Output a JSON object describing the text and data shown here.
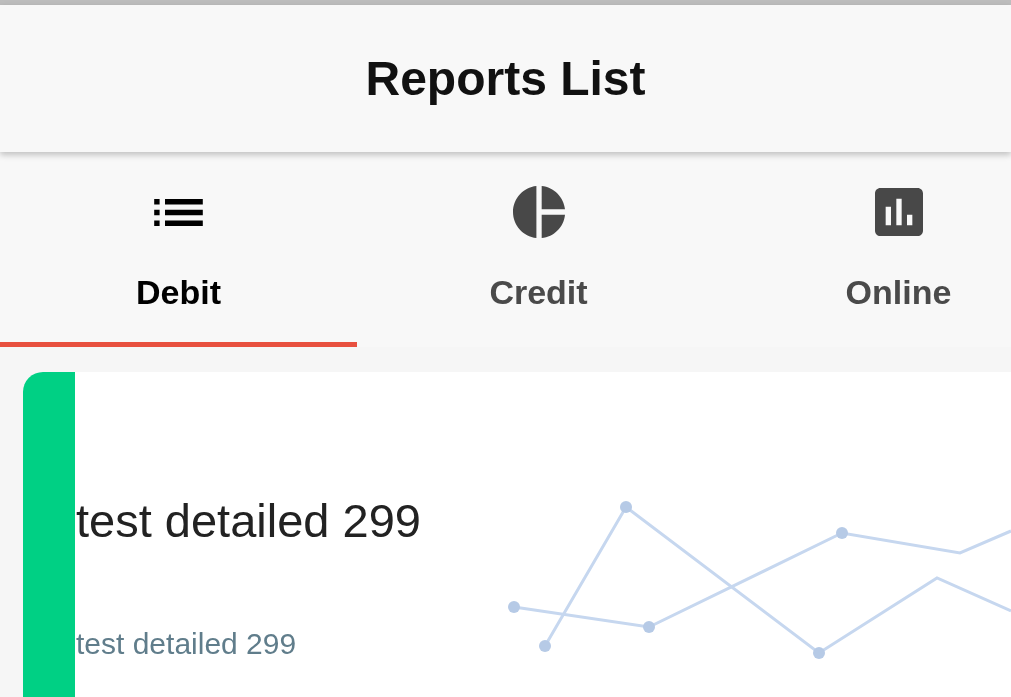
{
  "header": {
    "title": "Reports List"
  },
  "tabs": [
    {
      "label": "Debit",
      "selected": true
    },
    {
      "label": "Credit",
      "selected": false
    },
    {
      "label": "Online",
      "selected": false
    }
  ],
  "reports": [
    {
      "title": "test detailed 299",
      "subtitle": "test detailed 299",
      "color": "#00d084"
    }
  ]
}
